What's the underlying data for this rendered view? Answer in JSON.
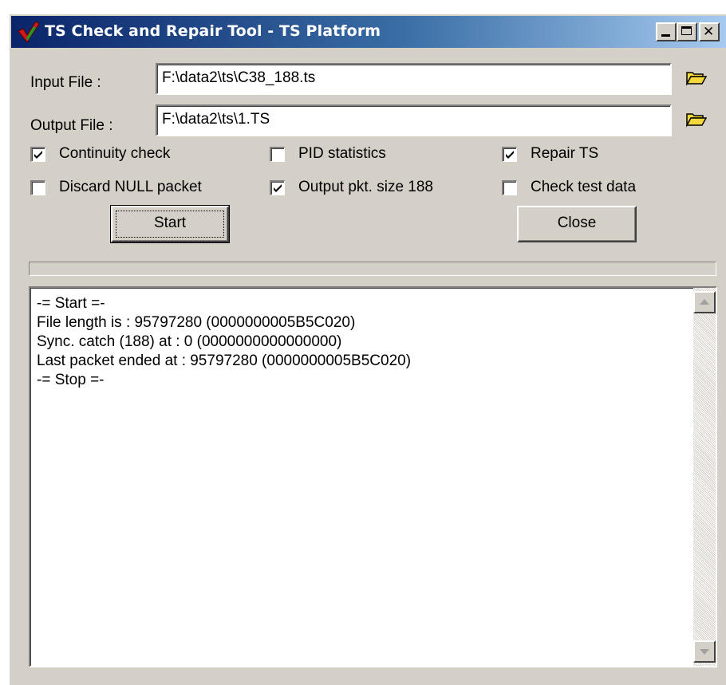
{
  "window": {
    "title": "TS Check and Repair Tool - TS Platform",
    "close_glyph": "✕"
  },
  "files": {
    "input_label": "Input File :",
    "input_value": "F:\\data2\\ts\\C38_188.ts",
    "output_label": "Output File :",
    "output_value": "F:\\data2\\ts\\1.TS"
  },
  "options": [
    {
      "label": "Continuity check",
      "checked": true
    },
    {
      "label": "PID statistics",
      "checked": false
    },
    {
      "label": "Repair TS",
      "checked": true
    },
    {
      "label": "Discard NULL packet",
      "checked": false
    },
    {
      "label": "Output pkt. size 188",
      "checked": true
    },
    {
      "label": "Check test data",
      "checked": false
    }
  ],
  "buttons": {
    "start_label": "Start",
    "close_label": "Close"
  },
  "progress": {
    "value": 0
  },
  "log": {
    "lines": [
      "-= Start =-",
      "File length is : 95797280 (0000000005B5C020)",
      "Sync. catch (188) at : 0 (0000000000000000)",
      "Last packet ended at : 95797280 (0000000005B5C020)",
      "-= Stop =-"
    ]
  },
  "icons": {
    "app": "red-check-icon",
    "browse": "open-folder-icon"
  },
  "colors": {
    "title_start": "#0a246a",
    "title_end": "#a6caf0",
    "face": "#d4d0c8",
    "folder": "#f5d83b"
  }
}
